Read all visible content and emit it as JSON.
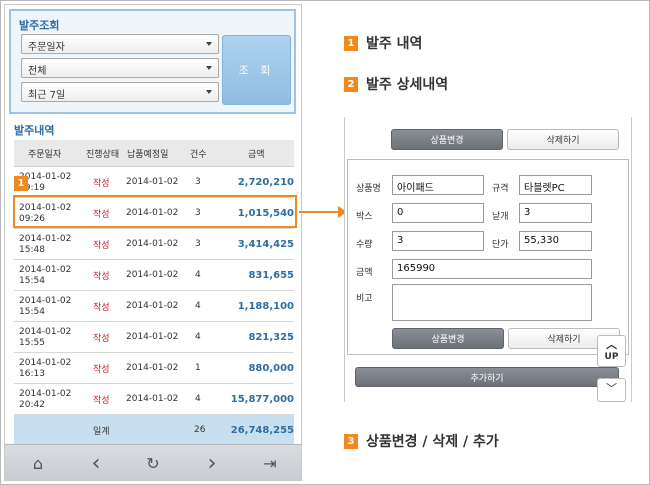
{
  "search": {
    "title": "발주조회",
    "select1": "주문일자",
    "select2": "전체",
    "select3": "최근 7일",
    "button": "조 회"
  },
  "list": {
    "title": "발주내역",
    "headers": [
      "주문일자",
      "진행상태",
      "납품예정일",
      "건수",
      "금액"
    ],
    "rows": [
      {
        "date": "2014-01-02",
        "time": "09:19",
        "status": "작성",
        "due": "2014-01-02",
        "count": "3",
        "amount": "2,720,210"
      },
      {
        "date": "2014-01-02",
        "time": "09:26",
        "status": "작성",
        "due": "2014-01-02",
        "count": "3",
        "amount": "1,015,540"
      },
      {
        "date": "2014-01-02",
        "time": "15:48",
        "status": "작성",
        "due": "2014-01-02",
        "count": "3",
        "amount": "3,414,425"
      },
      {
        "date": "2014-01-02",
        "time": "15:54",
        "status": "작성",
        "due": "2014-01-02",
        "count": "4",
        "amount": "831,655"
      },
      {
        "date": "2014-01-02",
        "time": "15:54",
        "status": "작성",
        "due": "2014-01-02",
        "count": "4",
        "amount": "1,188,100"
      },
      {
        "date": "2014-01-02",
        "time": "15:55",
        "status": "작성",
        "due": "2014-01-02",
        "count": "4",
        "amount": "821,325"
      },
      {
        "date": "2014-01-02",
        "time": "16:13",
        "status": "작성",
        "due": "2014-01-02",
        "count": "1",
        "amount": "880,000"
      },
      {
        "date": "2014-01-02",
        "time": "20:42",
        "status": "작성",
        "due": "2014-01-02",
        "count": "4",
        "amount": "15,877,000"
      }
    ],
    "footer": {
      "label": "일계",
      "count": "26",
      "amount": "26,748,255"
    }
  },
  "nav": {
    "home": "⌂",
    "back": "‹",
    "refresh": "↻",
    "forward": "›",
    "exit": "⇥"
  },
  "callouts": {
    "b1": "1",
    "t1": "발주 내역",
    "b2": "2",
    "t2": "발주 상세내역",
    "b3": "3",
    "t3": "상품변경 / 삭제 / 추가"
  },
  "detail": {
    "change_btn": "상품변경",
    "delete_btn": "삭제하기",
    "labels": {
      "product": "상품명",
      "spec": "규격",
      "box": "박스",
      "each": "낱개",
      "qty": "수량",
      "price": "단가",
      "amount": "금액",
      "note": "비고"
    },
    "values": {
      "product": "아이패드",
      "spec": "타블렛PC",
      "box": "0",
      "each": "3",
      "qty": "3",
      "price": "55,330",
      "amount": "165990",
      "note": ""
    },
    "add_btn": "추가하기",
    "up": "UP"
  },
  "colors": {
    "accent": "#f08a1e",
    "link": "#2e6da4",
    "status": "#d02020"
  }
}
